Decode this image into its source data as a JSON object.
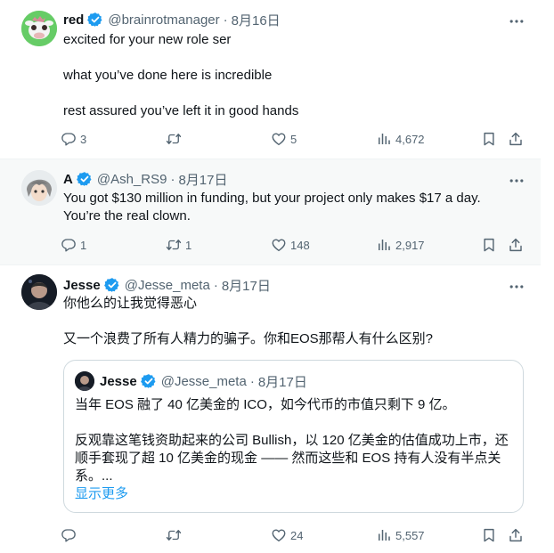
{
  "tweets": [
    {
      "name": "red",
      "handle": "@brainrotmanager",
      "date": "8月16日",
      "lines": [
        "excited for your new role ser",
        "what you’ve done here is incredible",
        "rest assured you’ve left it in good hands"
      ],
      "replies": "3",
      "retweets": "",
      "likes": "5",
      "views": "4,672"
    },
    {
      "name": "A",
      "handle": "@Ash_RS9",
      "date": "8月17日",
      "lines": [
        "You got $130 million in funding, but your project only makes $17 a day.",
        "You’re the real clown."
      ],
      "replies": "1",
      "retweets": "1",
      "likes": "148",
      "views": "2,917"
    },
    {
      "name": "Jesse",
      "handle": "@Jesse_meta",
      "date": "8月17日",
      "lines": [
        "你他么的让我觉得恶心",
        "又一个浪费了所有人精力的骗子。你和EOS那帮人有什么区别?"
      ],
      "replies": "",
      "retweets": "",
      "likes": "24",
      "views": "5,557",
      "quote": {
        "name": "Jesse",
        "handle": "@Jesse_meta",
        "date": "8月17日",
        "lines": [
          "当年 EOS 融了 40 亿美金的 ICO，如今代币的市值只剩下 9 亿。",
          "反观靠这笔钱资助起来的公司 Bullish，以 120 亿美金的估值成功上市，还",
          "顺手套现了超 10 亿美金的现金 —— 然而这些和 EOS 持有人没有半点关",
          "系。..."
        ],
        "show_more": "显示更多"
      }
    }
  ],
  "colors": {
    "verified": "#1d9bf0",
    "muted": "#536471",
    "link": "#1d9bf0"
  },
  "icons": [
    "verified-badge-icon",
    "more-icon",
    "reply-icon",
    "retweet-icon",
    "like-icon",
    "views-icon",
    "bookmark-icon",
    "share-icon"
  ]
}
